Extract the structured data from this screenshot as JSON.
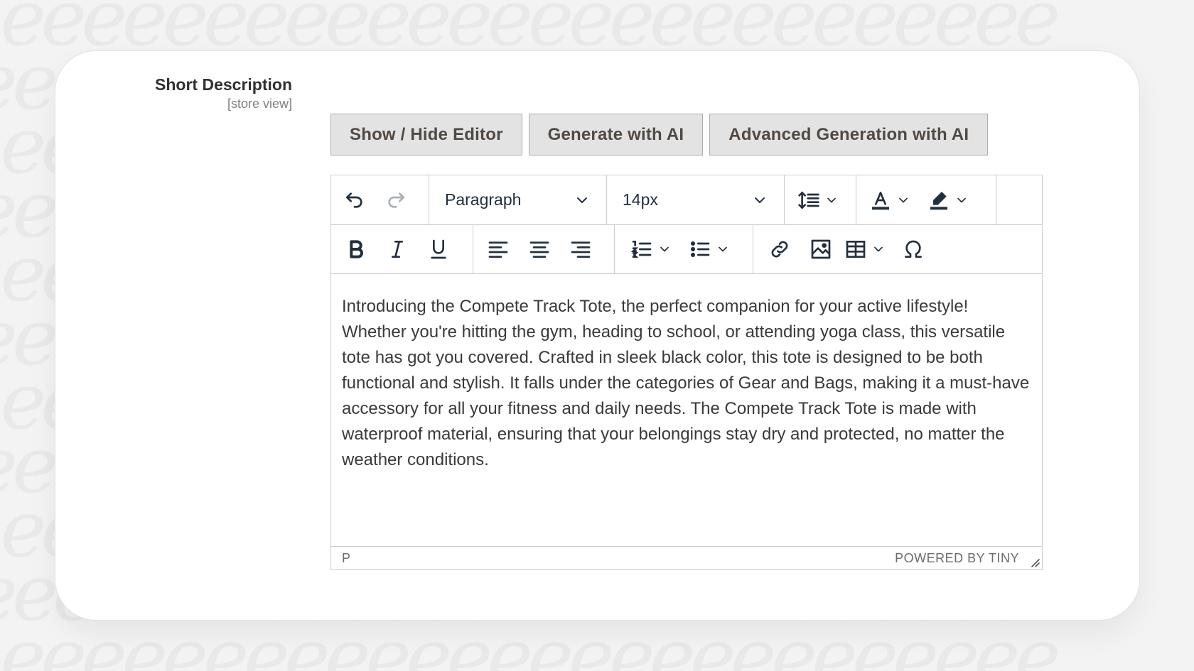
{
  "field": {
    "label": "Short Description",
    "scope": "[store view]"
  },
  "ai_buttons": {
    "show_hide": "Show / Hide Editor",
    "generate": "Generate with AI",
    "advanced": "Advanced Generation with AI"
  },
  "toolbar": {
    "block_format": "Paragraph",
    "font_size": "14px",
    "icons": [
      "undo-icon",
      "redo-icon",
      "line-height-icon",
      "text-color-icon",
      "highlight-color-icon",
      "bold-icon",
      "italic-icon",
      "underline-icon",
      "align-left-icon",
      "align-center-icon",
      "align-right-icon",
      "numbered-list-icon",
      "bullet-list-icon",
      "link-icon",
      "image-icon",
      "table-icon",
      "special-character-icon"
    ]
  },
  "content": {
    "text": "Introducing the Compete Track Tote, the perfect companion for your active lifestyle! Whether you're hitting the gym, heading to school, or attending yoga class, this versatile tote has got you covered. Crafted in sleek black color, this tote is designed to be both functional and stylish. It falls under the categories of Gear and Bags, making it a must-have accessory for all your fitness and daily needs. The Compete Track Tote is made with waterproof material, ensuring that your belongings stay dry and protected, no matter the weather conditions."
  },
  "statusbar": {
    "path": "P",
    "brand": "POWERED BY TINY"
  },
  "colors": {
    "button_bg": "#e3e3e3",
    "button_text": "#514943",
    "icon": "#222f3e",
    "icon_disabled": "#a8aeb5"
  }
}
